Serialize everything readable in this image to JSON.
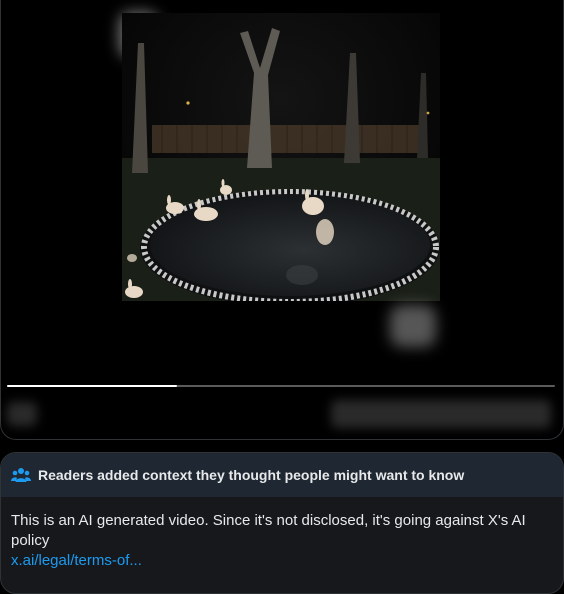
{
  "video": {
    "progress_fraction": 0.31
  },
  "community_note": {
    "header_icon": "people-group-icon",
    "header_text": "Readers added context they thought people might want to know",
    "body_text": "This is an AI generated video. Since it's not disclosed, it's going against X's AI policy",
    "link_text": "x.ai/legal/terms-of...",
    "accent_color": "#1d9bf0",
    "header_bg": "#1e2732"
  }
}
